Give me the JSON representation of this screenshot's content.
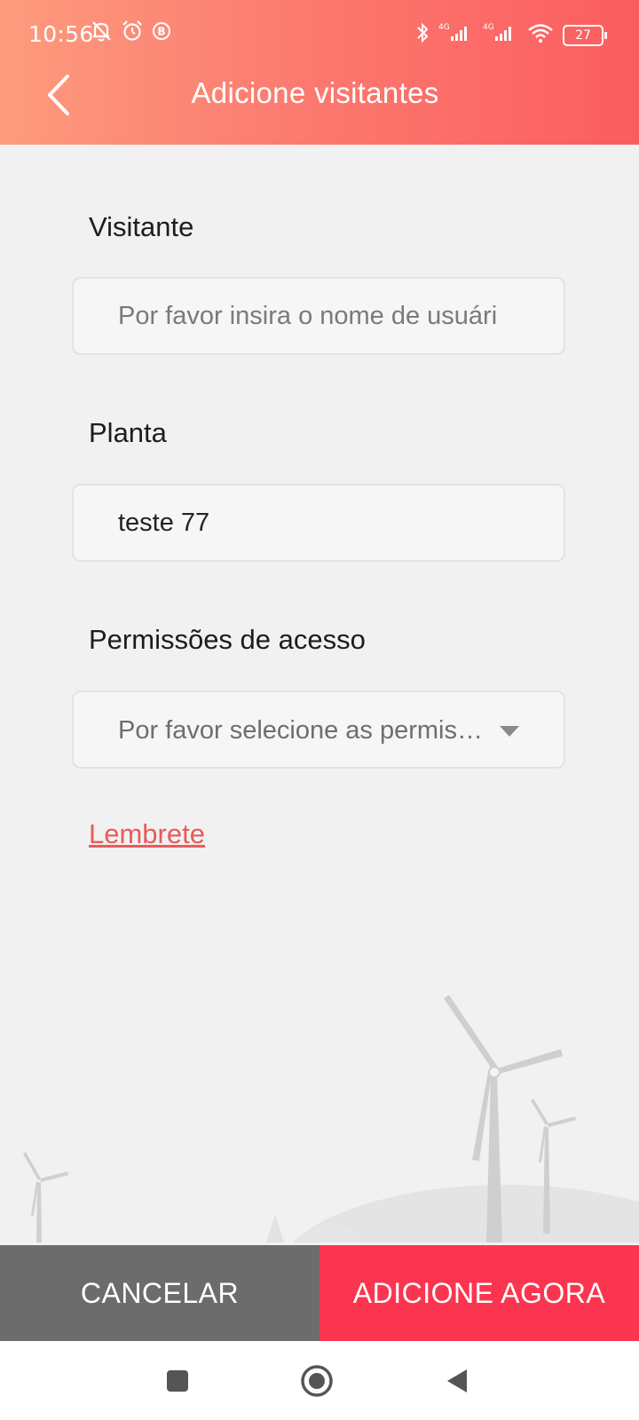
{
  "status_bar": {
    "time": "10:56",
    "battery_level": "27",
    "network_labels": [
      "4G",
      "4G"
    ],
    "icons": [
      "mute-icon",
      "alarm-icon",
      "b-badge-icon",
      "bluetooth-icon",
      "signal-icon",
      "signal-icon",
      "wifi-icon",
      "battery-icon"
    ]
  },
  "header": {
    "title": "Adicione visitantes",
    "back_icon": "chevron-left-icon"
  },
  "form": {
    "visitor": {
      "label": "Visitante",
      "placeholder": "Por favor insira o nome de usuári",
      "value": ""
    },
    "plant": {
      "label": "Planta",
      "value": "teste 77"
    },
    "permissions": {
      "label": "Permissões de acesso",
      "placeholder": "Por favor selecione as permis…",
      "dropdown_icon": "triangle-down-icon"
    },
    "reminder_link": "Lembrete"
  },
  "actions": {
    "cancel_label": "CANCELAR",
    "add_label": "ADICIONE AGORA"
  },
  "colors": {
    "header_gradient_start": "#fd9b7d",
    "header_gradient_end": "#fb5d5f",
    "link": "#ea5a5a",
    "cancel_bg": "#6c6c6c",
    "add_bg": "#fb3550"
  },
  "nav_bar": {
    "buttons": [
      "square-recents-icon",
      "circle-home-icon",
      "triangle-back-icon"
    ]
  }
}
